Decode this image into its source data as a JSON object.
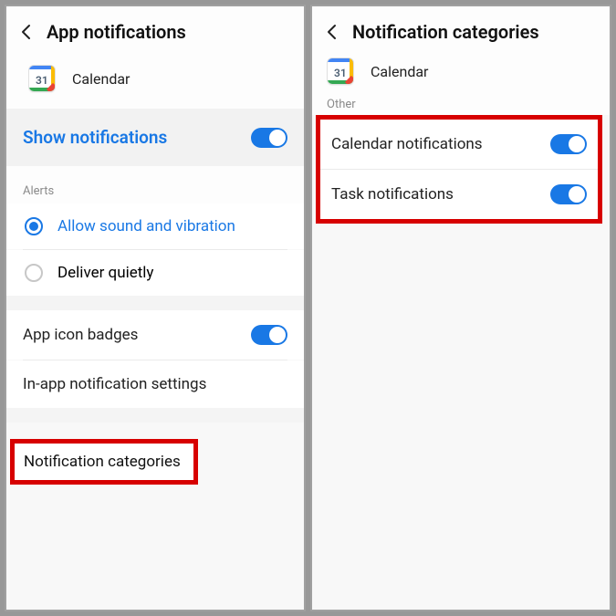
{
  "left": {
    "title": "App notifications",
    "app_name": "Calendar",
    "show_label": "Show notifications",
    "alerts_label": "Alerts",
    "alert_opts": {
      "sound": "Allow sound and vibration",
      "quiet": "Deliver quietly"
    },
    "badges_label": "App icon badges",
    "inapp_label": "In-app notification settings",
    "categories_label": "Notification categories"
  },
  "right": {
    "title": "Notification categories",
    "app_name": "Calendar",
    "other_label": "Other",
    "cal_notif": "Calendar notifications",
    "task_notif": "Task notifications"
  }
}
